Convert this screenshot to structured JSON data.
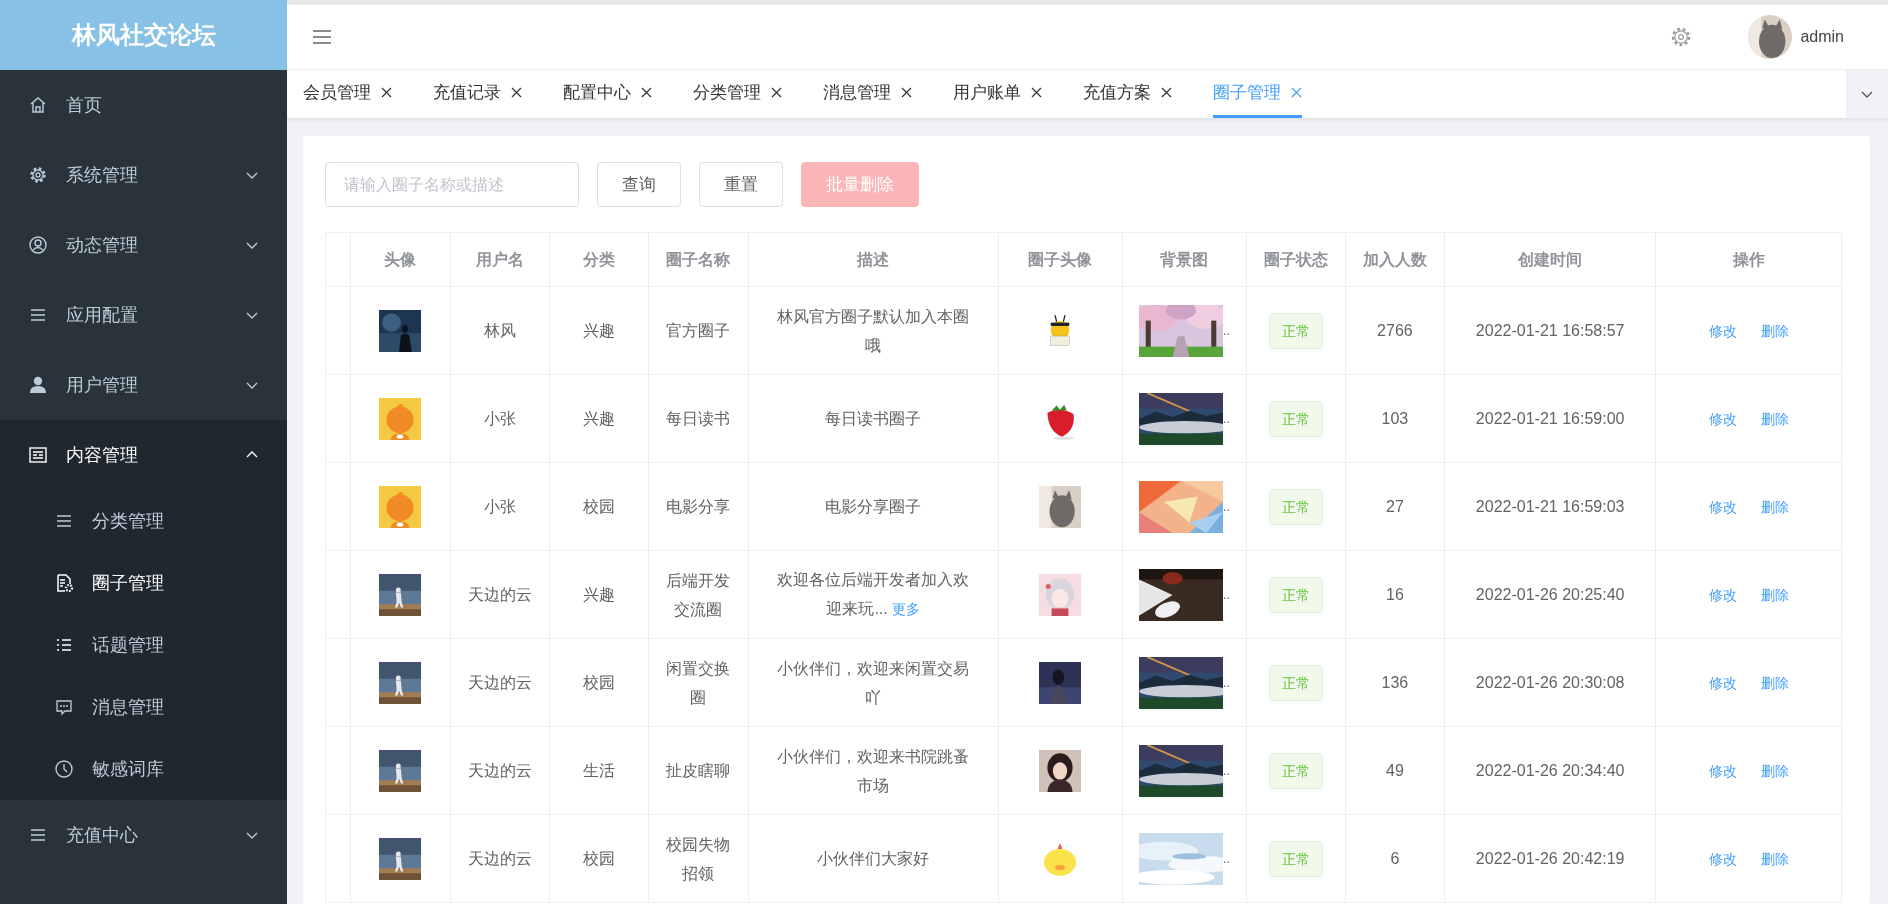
{
  "sidebar": {
    "logo": "林风社交论坛",
    "items": [
      {
        "label": "首页",
        "expanded": false,
        "has_children": false
      },
      {
        "label": "系统管理",
        "expanded": false,
        "has_children": true
      },
      {
        "label": "动态管理",
        "expanded": false,
        "has_children": true
      },
      {
        "label": "应用配置",
        "expanded": false,
        "has_children": true
      },
      {
        "label": "用户管理",
        "expanded": false,
        "has_children": true
      },
      {
        "label": "内容管理",
        "expanded": true,
        "has_children": true,
        "children": [
          {
            "label": "分类管理",
            "selected": false
          },
          {
            "label": "圈子管理",
            "selected": true
          },
          {
            "label": "话题管理",
            "selected": false
          },
          {
            "label": "消息管理",
            "selected": false
          },
          {
            "label": "敏感词库",
            "selected": false
          }
        ]
      },
      {
        "label": "充值中心",
        "expanded": false,
        "has_children": true
      }
    ]
  },
  "header": {
    "user": "admin"
  },
  "tabs": [
    {
      "label": "会员管理",
      "selected": false
    },
    {
      "label": "充值记录",
      "selected": false
    },
    {
      "label": "配置中心",
      "selected": false
    },
    {
      "label": "分类管理",
      "selected": false
    },
    {
      "label": "消息管理",
      "selected": false
    },
    {
      "label": "用户账单",
      "selected": false
    },
    {
      "label": "充值方案",
      "selected": false
    },
    {
      "label": "圈子管理",
      "selected": true
    }
  ],
  "toolbar": {
    "search": {
      "placeholder": "请输入圈子名称或描述"
    },
    "buttons": [
      {
        "label": "查询",
        "kind": "default",
        "disabled": false
      },
      {
        "label": "重置",
        "kind": "default",
        "disabled": false
      },
      {
        "label": "批量删除",
        "kind": "danger",
        "disabled": true
      }
    ]
  },
  "table": {
    "columns": [
      "头像",
      "用户名",
      "分类",
      "圈子名称",
      "描述",
      "圈子头像",
      "背景图",
      "圈子状态",
      "加入人数",
      "创建时间",
      "操作"
    ],
    "rows": [
      {
        "user": "林风",
        "category": "兴趣",
        "name": "官方圈子",
        "desc": "林风官方圈子默认加入本圈哦",
        "bg_overflow": "..",
        "status": {
          "text": "正常",
          "kind": "success"
        },
        "members": "2766",
        "created": "2022-01-21 16:58:57",
        "actions": [
          "修改",
          "删除"
        ]
      },
      {
        "user": "小张",
        "category": "兴趣",
        "name": "每日读书",
        "desc": "每日读书圈子",
        "bg_overflow": "..",
        "status": {
          "text": "正常",
          "kind": "success"
        },
        "members": "103",
        "created": "2022-01-21 16:59:00",
        "actions": [
          "修改",
          "删除"
        ]
      },
      {
        "user": "小张",
        "category": "校园",
        "name": "电影分享",
        "desc": "电影分享圈子",
        "bg_overflow": "..",
        "status": {
          "text": "正常",
          "kind": "success"
        },
        "members": "27",
        "created": "2022-01-21 16:59:03",
        "actions": [
          "修改",
          "删除"
        ]
      },
      {
        "user": "天边的云",
        "category": "兴趣",
        "name": "后端开发交流圈",
        "desc": "欢迎各位后端开发者加入欢迎来玩...",
        "more": "更多",
        "bg_overflow": "..",
        "status": {
          "text": "正常",
          "kind": "success"
        },
        "members": "16",
        "created": "2022-01-26 20:25:40",
        "actions": [
          "修改",
          "删除"
        ]
      },
      {
        "user": "天边的云",
        "category": "校园",
        "name": "闲置交换圈",
        "desc": "小伙伴们，欢迎来闲置交易吖",
        "bg_overflow": "..",
        "status": {
          "text": "正常",
          "kind": "success"
        },
        "members": "136",
        "created": "2022-01-26 20:30:08",
        "actions": [
          "修改",
          "删除"
        ]
      },
      {
        "user": "天边的云",
        "category": "生活",
        "name": "扯皮瞎聊",
        "desc": "小伙伴们，欢迎来书院跳蚤市场",
        "bg_overflow": "..",
        "status": {
          "text": "正常",
          "kind": "success"
        },
        "members": "49",
        "created": "2022-01-26 20:34:40",
        "actions": [
          "修改",
          "删除"
        ]
      },
      {
        "user": "天边的云",
        "category": "校园",
        "name": "校园失物招领",
        "desc": "小伙伴们大家好",
        "bg_overflow": "..",
        "status": {
          "text": "正常",
          "kind": "success"
        },
        "members": "6",
        "created": "2022-01-26 20:42:19",
        "actions": [
          "修改",
          "删除"
        ]
      }
    ]
  }
}
